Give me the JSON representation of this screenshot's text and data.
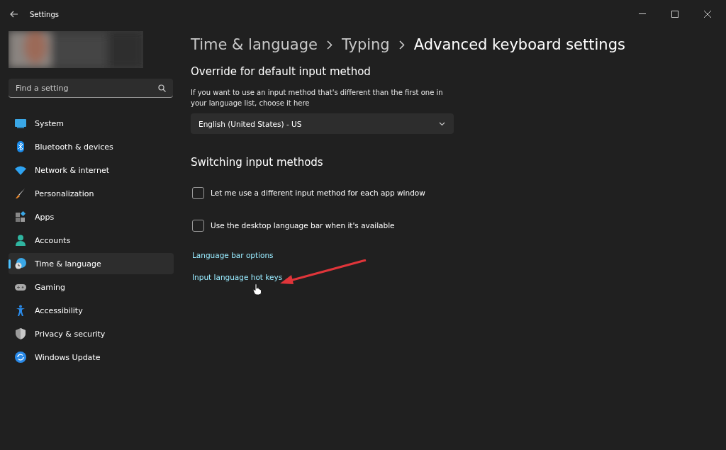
{
  "window": {
    "title": "Settings"
  },
  "search": {
    "placeholder": "Find a setting"
  },
  "sidebar": {
    "items": [
      {
        "label": "System",
        "selected": false
      },
      {
        "label": "Bluetooth & devices",
        "selected": false
      },
      {
        "label": "Network & internet",
        "selected": false
      },
      {
        "label": "Personalization",
        "selected": false
      },
      {
        "label": "Apps",
        "selected": false
      },
      {
        "label": "Accounts",
        "selected": false
      },
      {
        "label": "Time & language",
        "selected": true
      },
      {
        "label": "Gaming",
        "selected": false
      },
      {
        "label": "Accessibility",
        "selected": false
      },
      {
        "label": "Privacy & security",
        "selected": false
      },
      {
        "label": "Windows Update",
        "selected": false
      }
    ]
  },
  "breadcrumb": [
    "Time & language",
    "Typing",
    "Advanced keyboard settings"
  ],
  "override": {
    "heading": "Override for default input method",
    "description": "If you want to use an input method that's different than the first one in your language list, choose it here",
    "dropdown": {
      "value": "English (United States) - US"
    }
  },
  "switching": {
    "heading": "Switching input methods",
    "options": [
      {
        "label": "Let me use a different input method for each app window",
        "checked": false
      },
      {
        "label": "Use the desktop language bar when it's available",
        "checked": false
      }
    ],
    "links": [
      "Language bar options",
      "Input language hot keys"
    ]
  }
}
